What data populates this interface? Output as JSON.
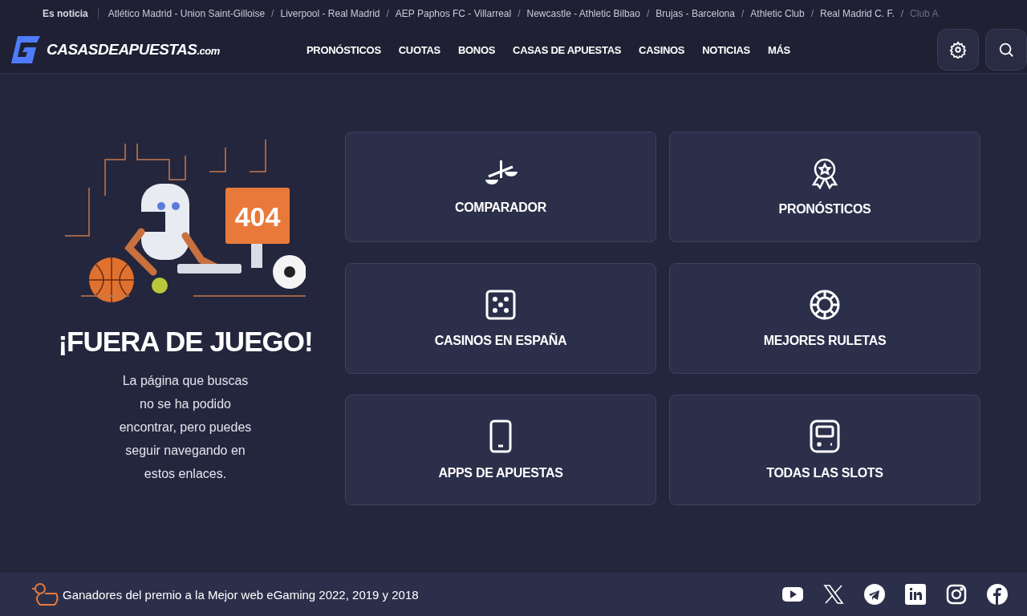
{
  "ticker": {
    "label": "Es noticia",
    "items": [
      "Atlético Madrid - Union Saint-Gilloise",
      "Liverpool - Real Madrid",
      "AEP Paphos FC - Villarreal",
      "Newcastle - Athletic Bilbao",
      "Brujas - Barcelona",
      "Athletic Club",
      "Real Madrid C. F.",
      "Club A"
    ],
    "separator": "/"
  },
  "logo": {
    "name": "CASASDEAPUESTAS",
    "suffix": ".com"
  },
  "nav": [
    "PRONÓSTICOS",
    "CUOTAS",
    "BONOS",
    "CASAS DE APUESTAS",
    "CASINOS",
    "NOTICIAS",
    "MÁS"
  ],
  "illustration": {
    "screen_text": "404"
  },
  "heading": "¡FUERA DE JUEGO!",
  "message": "La página que buscas no se ha podido encontrar, pero puedes seguir navegando en estos enlaces.",
  "links": [
    "COMPARADOR",
    "PRONÓSTICOS",
    "CASINOS EN ESPAÑA",
    "MEJORES RULETAS",
    "APPS DE APUESTAS",
    "TODAS LAS SLOTS"
  ],
  "footer": {
    "award": "Ganadores del premio a la Mejor web eGaming 2022, 2019 y 2018"
  }
}
